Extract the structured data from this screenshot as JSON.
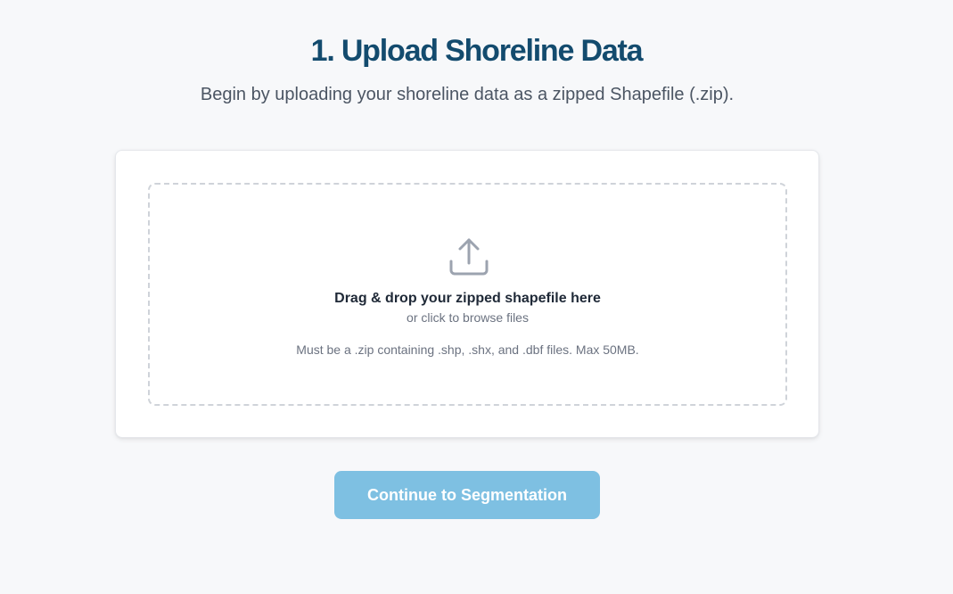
{
  "header": {
    "title": "1. Upload Shoreline Data",
    "subtitle": "Begin by uploading your shoreline data as a zipped Shapefile (.zip)."
  },
  "dropzone": {
    "icon": "upload-icon",
    "title": "Drag & drop your zipped shapefile here",
    "subtitle": "or click to browse files",
    "hint": "Must be a .zip containing .shp, .shx, and .dbf files. Max 50MB."
  },
  "actions": {
    "continue_label": "Continue to Segmentation",
    "continue_disabled": true
  },
  "colors": {
    "title": "#134b6e",
    "button_disabled": "#7ec0e2",
    "background": "#f7f8fa"
  }
}
